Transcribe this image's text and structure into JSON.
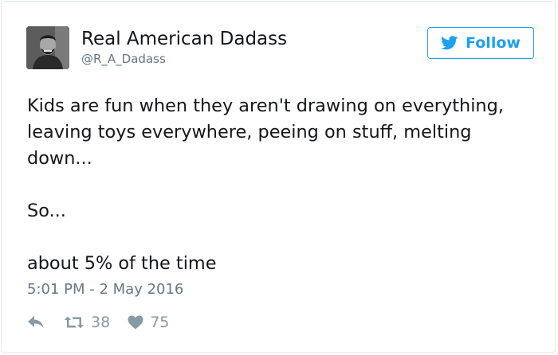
{
  "tweet": {
    "user": {
      "display_name": "Real American Dadass",
      "handle": "@R_A_Dadass"
    },
    "follow_label": "Follow",
    "paragraphs": [
      "Kids are fun when they aren't drawing on everything, leaving toys everywhere, peeing on stuff, melting down...",
      "So...",
      "about 5% of the time"
    ],
    "timestamp": "5:01 PM - 2 May 2016",
    "retweet_count": "38",
    "like_count": "75"
  },
  "colors": {
    "brand_blue": "#1da1f2",
    "text": "#14171a",
    "muted": "#657786",
    "action_gray": "#8899a6",
    "border": "#e1e8ed"
  },
  "icons": {
    "reply": "reply-arrow",
    "retweet": "retweet-arrows",
    "like": "heart",
    "follow": "twitter-bird"
  }
}
